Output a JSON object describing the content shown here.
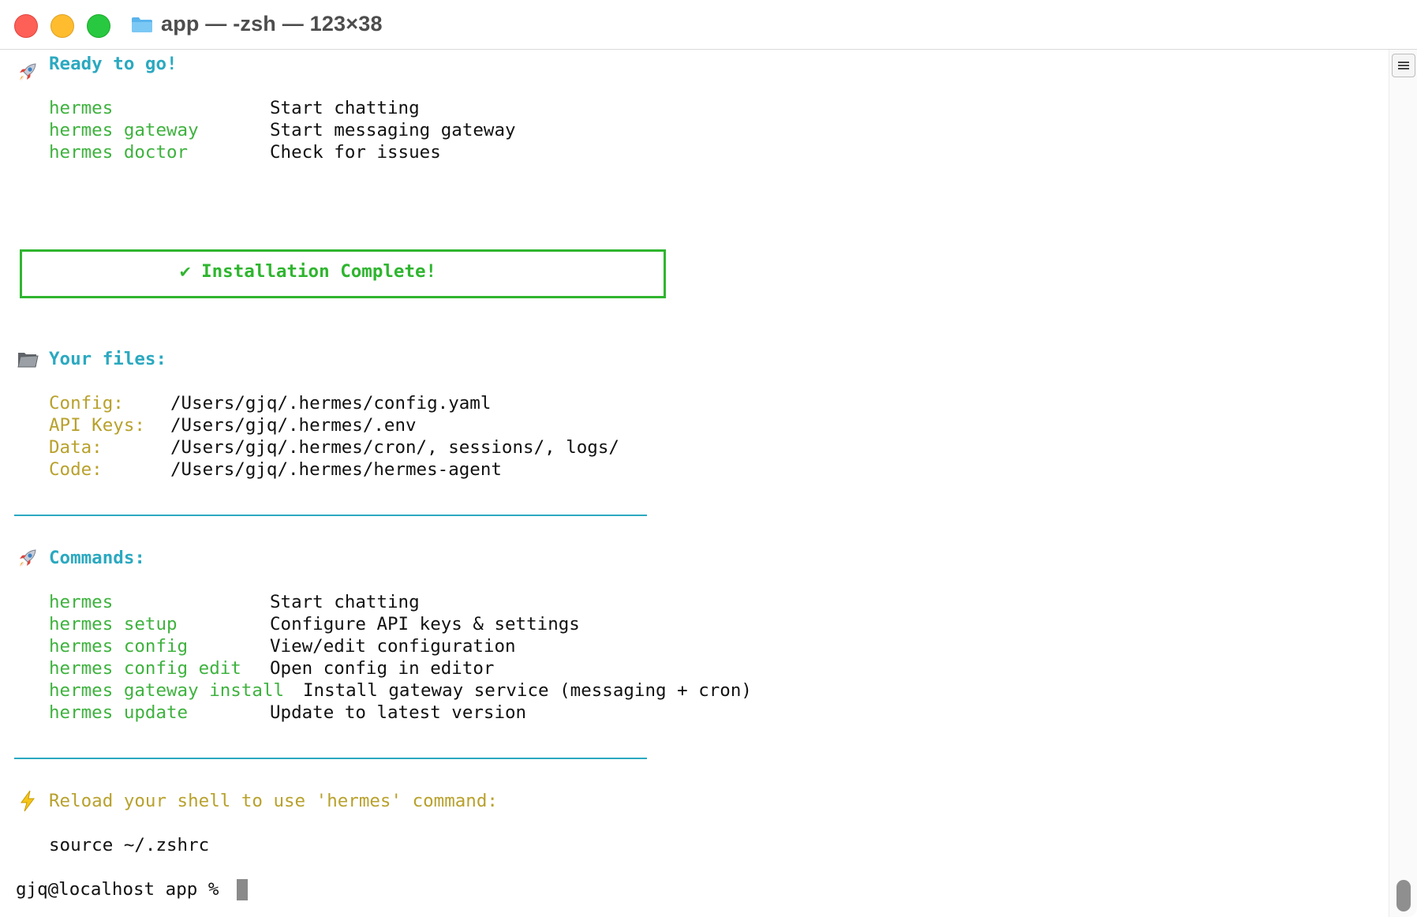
{
  "window": {
    "title": "app — -zsh — 123×38"
  },
  "ready": {
    "heading": "Ready to go!",
    "commands": [
      {
        "cmd": "hermes",
        "desc": "Start chatting"
      },
      {
        "cmd": "hermes gateway",
        "desc": "Start messaging gateway"
      },
      {
        "cmd": "hermes doctor",
        "desc": "Check for issues"
      }
    ]
  },
  "banner": {
    "text": "✔ Installation Complete!"
  },
  "files": {
    "heading": "Your files:",
    "rows": [
      {
        "label": "Config:",
        "path": "/Users/gjq/.hermes/config.yaml"
      },
      {
        "label": "API Keys:",
        "path": "/Users/gjq/.hermes/.env"
      },
      {
        "label": "Data:",
        "path": "/Users/gjq/.hermes/cron/, sessions/, logs/"
      },
      {
        "label": "Code:",
        "path": "/Users/gjq/.hermes/hermes-agent"
      }
    ]
  },
  "commands": {
    "heading": "Commands:",
    "rows": [
      {
        "cmd": "hermes",
        "desc": "Start chatting"
      },
      {
        "cmd": "hermes setup",
        "desc": "Configure API keys & settings"
      },
      {
        "cmd": "hermes config",
        "desc": "View/edit configuration"
      },
      {
        "cmd": "hermes config edit",
        "desc": "Open config in editor"
      },
      {
        "cmd": "hermes gateway install",
        "desc": "Install gateway service (messaging + cron)"
      },
      {
        "cmd": "hermes update",
        "desc": "Update to latest version"
      }
    ]
  },
  "reload": {
    "message": "Reload your shell to use 'hermes' command:",
    "command": "source ~/.zshrc"
  },
  "prompt": {
    "text": "gjq@localhost app % "
  },
  "colors": {
    "heading": "#2ba9c0",
    "command": "#3eb23e",
    "label": "#b8a12c",
    "success": "#2fb52f"
  },
  "icons": [
    "rocket-icon",
    "folder-icon",
    "lightning-icon",
    "check-icon"
  ]
}
